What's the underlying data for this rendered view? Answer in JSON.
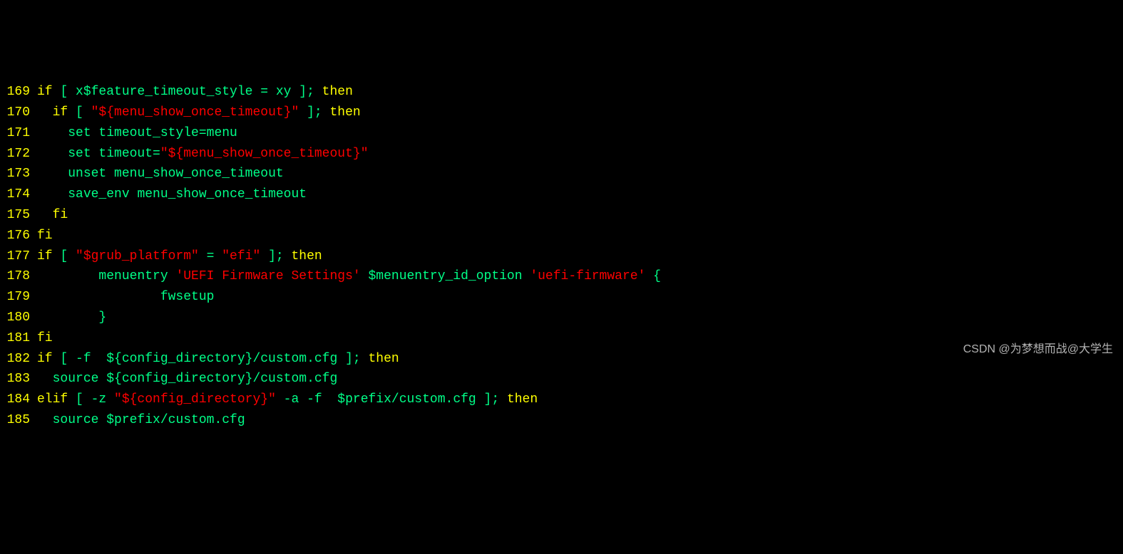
{
  "lines": [
    {
      "num": "169",
      "segments": [
        {
          "cls": "kw",
          "t": "if"
        },
        {
          "cls": "def",
          "t": " [ x$feature_timeout_style = xy ]; "
        },
        {
          "cls": "kw",
          "t": "then"
        }
      ]
    },
    {
      "num": "170",
      "segments": [
        {
          "cls": "def",
          "t": "  "
        },
        {
          "cls": "kw",
          "t": "if"
        },
        {
          "cls": "def",
          "t": " [ "
        },
        {
          "cls": "str",
          "t": "\"${menu_show_once_timeout}\""
        },
        {
          "cls": "def",
          "t": " ]; "
        },
        {
          "cls": "kw",
          "t": "then"
        }
      ]
    },
    {
      "num": "171",
      "segments": [
        {
          "cls": "def",
          "t": "    "
        },
        {
          "cls": "cmd",
          "t": "set"
        },
        {
          "cls": "def",
          "t": " timeout_style=menu"
        }
      ]
    },
    {
      "num": "172",
      "segments": [
        {
          "cls": "def",
          "t": "    "
        },
        {
          "cls": "cmd",
          "t": "set"
        },
        {
          "cls": "def",
          "t": " timeout="
        },
        {
          "cls": "str",
          "t": "\"${menu_show_once_timeout}\""
        }
      ]
    },
    {
      "num": "173",
      "segments": [
        {
          "cls": "def",
          "t": "    "
        },
        {
          "cls": "cmd",
          "t": "unset"
        },
        {
          "cls": "def",
          "t": " menu_show_once_timeout"
        }
      ]
    },
    {
      "num": "174",
      "segments": [
        {
          "cls": "def",
          "t": "    "
        },
        {
          "cls": "cmd",
          "t": "save_env"
        },
        {
          "cls": "def",
          "t": " menu_show_once_timeout"
        }
      ]
    },
    {
      "num": "175",
      "segments": [
        {
          "cls": "def",
          "t": "  "
        },
        {
          "cls": "kw",
          "t": "fi"
        }
      ]
    },
    {
      "num": "176",
      "segments": [
        {
          "cls": "kw",
          "t": "fi"
        }
      ]
    },
    {
      "num": "177",
      "segments": [
        {
          "cls": "kw",
          "t": "if"
        },
        {
          "cls": "def",
          "t": " [ "
        },
        {
          "cls": "str",
          "t": "\"$grub_platform\""
        },
        {
          "cls": "def",
          "t": " = "
        },
        {
          "cls": "str",
          "t": "\"efi\""
        },
        {
          "cls": "def",
          "t": " ]; "
        },
        {
          "cls": "kw",
          "t": "then"
        }
      ]
    },
    {
      "num": "178",
      "segments": [
        {
          "cls": "def",
          "t": "        menuentry "
        },
        {
          "cls": "str",
          "t": "'UEFI Firmware Settings'"
        },
        {
          "cls": "def",
          "t": " $menuentry_id_option "
        },
        {
          "cls": "str",
          "t": "'uefi-firmware'"
        },
        {
          "cls": "def",
          "t": " {"
        }
      ]
    },
    {
      "num": "179",
      "segments": [
        {
          "cls": "def",
          "t": "                fwsetup"
        }
      ]
    },
    {
      "num": "180",
      "segments": [
        {
          "cls": "def",
          "t": "        }"
        }
      ]
    },
    {
      "num": "181",
      "segments": [
        {
          "cls": "kw",
          "t": "fi"
        }
      ]
    },
    {
      "num": "182",
      "segments": [
        {
          "cls": "kw",
          "t": "if"
        },
        {
          "cls": "def",
          "t": " [ -f  ${config_directory}/custom.cfg ]; "
        },
        {
          "cls": "kw",
          "t": "then"
        }
      ]
    },
    {
      "num": "183",
      "segments": [
        {
          "cls": "def",
          "t": "  "
        },
        {
          "cls": "cmd",
          "t": "source"
        },
        {
          "cls": "def",
          "t": " ${config_directory}/custom.cfg"
        }
      ]
    },
    {
      "num": "184",
      "segments": [
        {
          "cls": "kw",
          "t": "elif"
        },
        {
          "cls": "def",
          "t": " [ -z "
        },
        {
          "cls": "str",
          "t": "\"${config_directory}\""
        },
        {
          "cls": "def",
          "t": " -a -f  $prefix/custom.cfg ]; "
        },
        {
          "cls": "kw",
          "t": "then"
        }
      ]
    },
    {
      "num": "185",
      "segments": [
        {
          "cls": "def",
          "t": "  "
        },
        {
          "cls": "cmd",
          "t": "source"
        },
        {
          "cls": "def",
          "t": " $prefix/custom.cfg"
        }
      ]
    }
  ],
  "watermark": "CSDN @为梦想而战@大学生"
}
